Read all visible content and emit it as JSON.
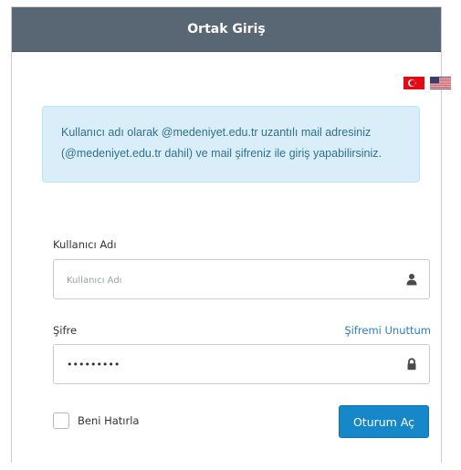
{
  "header": {
    "title": "Ortak Giriş"
  },
  "languages": {
    "options": [
      {
        "code": "tr",
        "icon": "turkish-flag-icon"
      },
      {
        "code": "en",
        "icon": "us-flag-icon"
      }
    ]
  },
  "alert": {
    "message": "Kullanıcı adı olarak @medeniyet.edu.tr uzantılı mail adresiniz (@medeniyet.edu.tr dahil) ve mail şifreniz ile giriş yapabilirsiniz."
  },
  "form": {
    "username": {
      "label": "Kullanıcı Adı",
      "placeholder": "Kullanıcı Adı",
      "value": "",
      "icon": "user-icon"
    },
    "password": {
      "label": "Şifre",
      "value": "•••••••••",
      "icon": "lock-icon",
      "forgot_label": "Şifremi Unuttum"
    },
    "remember": {
      "label": "Beni Hatırla",
      "checked": false
    },
    "submit_label": "Oturum Aç"
  },
  "colors": {
    "header_bg": "#596673",
    "alert_bg": "#d9eef8",
    "alert_text": "#31708f",
    "link": "#2a7dbd",
    "button_bg": "#1688c9"
  }
}
